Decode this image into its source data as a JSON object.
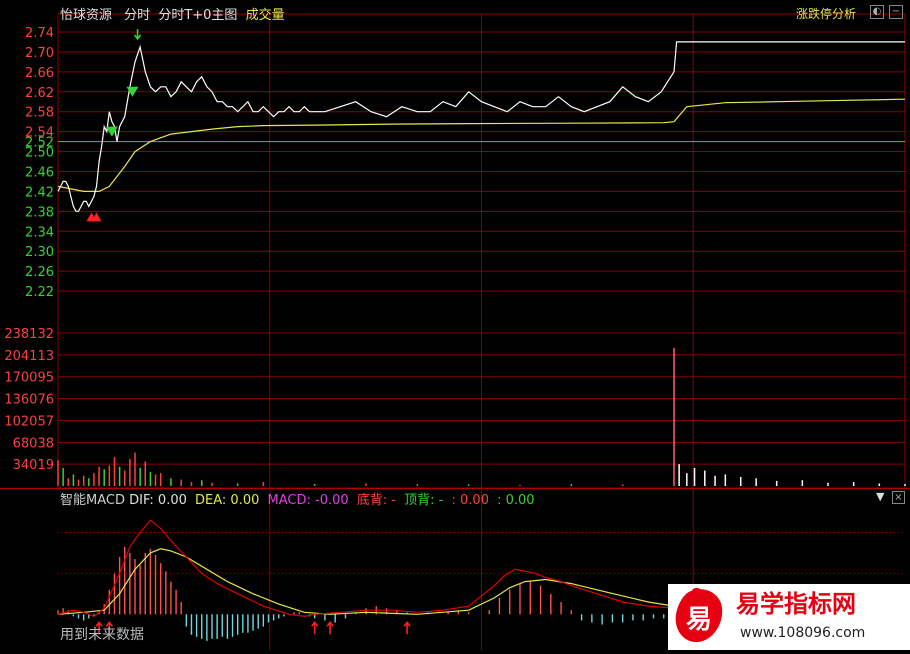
{
  "header": {
    "stock_name": "怡球资源",
    "mode_1": "分时",
    "mode_2": "分时T+0主图",
    "mode_3": "成交量",
    "analysis_label": "涨跌停分析"
  },
  "colors": {
    "price_up": "#ff4040",
    "price_down": "#35d435",
    "price_line": "#ffffff",
    "avg_line": "#e6e64a",
    "grid": "#8b0000",
    "macd_pos": "#ff5050",
    "macd_neg": "#70d8e0",
    "dea": "#e6e64a",
    "dif": "#e00000"
  },
  "chart_data": [
    {
      "type": "line",
      "panel": "price",
      "prev_close": 2.52,
      "ylim": [
        2.18,
        2.76
      ],
      "y_ticks": [
        "2.74",
        "2.70",
        "2.66",
        "2.62",
        "2.58",
        "2.54",
        "2.50",
        "2.46",
        "2.42",
        "2.38",
        "2.34",
        "2.30",
        "2.26",
        "2.22"
      ],
      "series": [
        {
          "role": "price",
          "x": [
            0,
            1,
            2,
            3,
            4,
            5,
            6,
            7,
            8,
            9,
            10,
            11,
            12,
            13,
            14,
            15,
            16,
            17,
            18,
            19,
            20,
            21,
            22,
            23,
            24,
            26,
            28,
            30,
            32,
            34,
            36,
            38,
            40,
            42,
            44,
            46,
            48,
            50,
            52,
            54,
            56,
            58,
            60,
            62,
            64,
            66,
            68,
            70,
            72,
            74,
            76,
            78,
            80,
            82,
            84,
            86,
            88,
            90,
            92,
            94,
            96,
            98,
            100,
            104,
            110,
            116,
            122,
            128,
            134,
            140,
            145,
            150,
            155,
            160,
            165,
            170,
            175,
            180,
            185,
            190,
            195,
            200,
            205,
            210,
            215,
            220,
            225,
            230,
            235,
            240,
            241,
            330
          ],
          "y": [
            2.42,
            2.43,
            2.44,
            2.44,
            2.43,
            2.41,
            2.39,
            2.38,
            2.38,
            2.39,
            2.4,
            2.4,
            2.39,
            2.4,
            2.41,
            2.43,
            2.48,
            2.51,
            2.55,
            2.54,
            2.58,
            2.56,
            2.55,
            2.52,
            2.55,
            2.57,
            2.63,
            2.68,
            2.71,
            2.66,
            2.63,
            2.62,
            2.63,
            2.63,
            2.61,
            2.62,
            2.64,
            2.63,
            2.62,
            2.64,
            2.65,
            2.63,
            2.62,
            2.6,
            2.6,
            2.59,
            2.59,
            2.58,
            2.59,
            2.6,
            2.58,
            2.58,
            2.59,
            2.58,
            2.57,
            2.58,
            2.58,
            2.59,
            2.58,
            2.58,
            2.59,
            2.58,
            2.58,
            2.58,
            2.59,
            2.6,
            2.58,
            2.57,
            2.59,
            2.58,
            2.58,
            2.6,
            2.59,
            2.62,
            2.6,
            2.59,
            2.58,
            2.6,
            2.59,
            2.59,
            2.61,
            2.59,
            2.58,
            2.59,
            2.6,
            2.63,
            2.61,
            2.6,
            2.62,
            2.66,
            2.72,
            2.72
          ]
        },
        {
          "role": "average",
          "x": [
            0,
            10,
            16,
            20,
            26,
            30,
            36,
            44,
            52,
            60,
            70,
            80,
            100,
            130,
            160,
            200,
            236,
            240,
            245,
            260,
            300,
            330
          ],
          "y": [
            2.43,
            2.42,
            2.42,
            2.43,
            2.47,
            2.5,
            2.52,
            2.535,
            2.54,
            2.545,
            2.55,
            2.552,
            2.553,
            2.555,
            2.556,
            2.557,
            2.558,
            2.56,
            2.59,
            2.598,
            2.602,
            2.605
          ]
        }
      ],
      "markers": [
        {
          "kind": "buy-arrow",
          "x": 13,
          "y": 2.37
        },
        {
          "kind": "buy-arrow",
          "x": 15,
          "y": 2.37
        },
        {
          "kind": "sell-triangle",
          "x": 21,
          "y": 2.54
        },
        {
          "kind": "sell-triangle",
          "x": 29,
          "y": 2.62
        },
        {
          "kind": "sell-arrow",
          "x": 31,
          "y": 2.73
        }
      ]
    },
    {
      "type": "bar",
      "panel": "volume",
      "ylim": [
        0,
        238132
      ],
      "y_ticks": [
        "238132",
        "204113",
        "170095",
        "136076",
        "102057",
        "68038",
        "34019"
      ],
      "x": [
        0,
        2,
        4,
        6,
        8,
        10,
        12,
        14,
        16,
        18,
        20,
        22,
        24,
        26,
        28,
        30,
        32,
        34,
        36,
        38,
        40,
        44,
        48,
        52,
        56,
        60,
        70,
        80,
        100,
        120,
        140,
        160,
        180,
        200,
        220,
        240,
        242,
        245,
        248,
        252,
        256,
        260,
        266,
        272,
        280,
        290,
        300,
        310,
        320,
        330
      ],
      "values": [
        40000,
        28000,
        12000,
        18000,
        10000,
        16000,
        12000,
        20000,
        30000,
        26000,
        32000,
        45000,
        30000,
        24000,
        42000,
        52000,
        28000,
        38000,
        22000,
        18000,
        20000,
        12000,
        10000,
        6000,
        9000,
        5000,
        4000,
        6000,
        3000,
        4000,
        3000,
        2500,
        2000,
        3000,
        2500,
        215000,
        34000,
        20000,
        28000,
        24000,
        16000,
        18000,
        14000,
        12000,
        8000,
        9000,
        5000,
        6000,
        4000,
        3000
      ],
      "up": [
        1,
        0,
        1,
        0,
        1,
        1,
        0,
        1,
        1,
        0,
        1,
        1,
        0,
        1,
        1,
        1,
        0,
        1,
        0,
        1,
        1,
        0,
        1,
        1,
        0,
        1,
        0,
        1,
        0,
        1,
        1,
        0,
        1,
        0,
        1,
        1,
        0,
        0,
        0,
        1,
        0,
        0,
        0,
        1,
        0,
        0,
        1,
        0,
        0,
        1
      ]
    },
    {
      "type": "bar",
      "panel": "macd",
      "title": "智能MACD",
      "labels": {
        "dif": "DIF: 0.00",
        "dea": "DEA: 0.00",
        "macd": "MACD: -0.00",
        "bottom": "底背: -",
        "top": "顶背: -",
        "extra_1": ": 0.00",
        "extra_2": ": 0.00"
      },
      "ylim": [
        -0.015,
        0.05
      ],
      "x": [
        0,
        2,
        4,
        6,
        8,
        10,
        12,
        14,
        16,
        18,
        20,
        22,
        24,
        26,
        28,
        30,
        32,
        34,
        36,
        38,
        40,
        42,
        44,
        46,
        48,
        50,
        52,
        54,
        56,
        58,
        60,
        62,
        64,
        66,
        68,
        70,
        72,
        74,
        76,
        78,
        80,
        82,
        84,
        86,
        88,
        90,
        92,
        94,
        96,
        98,
        100,
        104,
        108,
        112,
        116,
        120,
        124,
        128,
        132,
        136,
        140,
        144,
        148,
        152,
        156,
        160,
        164,
        168,
        172,
        176,
        180,
        184,
        188,
        192,
        196,
        200,
        204,
        208,
        212,
        216,
        220,
        224,
        228,
        232,
        236,
        240,
        244,
        248,
        252,
        256,
        260,
        264,
        268,
        272,
        276,
        280,
        284,
        290,
        300,
        310,
        320,
        330
      ],
      "values": [
        0.002,
        0.003,
        0.002,
        -0.001,
        -0.002,
        -0.003,
        -0.002,
        -0.001,
        0.001,
        0.005,
        0.012,
        0.02,
        0.028,
        0.033,
        0.03,
        0.027,
        0.024,
        0.03,
        0.032,
        0.029,
        0.025,
        0.021,
        0.016,
        0.012,
        0.006,
        -0.006,
        -0.01,
        -0.011,
        -0.012,
        -0.013,
        -0.012,
        -0.012,
        -0.011,
        -0.012,
        -0.011,
        -0.01,
        -0.009,
        -0.009,
        -0.008,
        -0.007,
        -0.006,
        -0.004,
        -0.003,
        -0.002,
        -0.001,
        0.0,
        0.001,
        0.001,
        0.0,
        -0.001,
        -0.002,
        -0.003,
        -0.004,
        -0.002,
        0.001,
        0.003,
        0.004,
        0.003,
        0.002,
        0.001,
        0.0,
        0.001,
        0.0,
        0.001,
        0.002,
        0.001,
        0.0,
        0.002,
        0.008,
        0.012,
        0.015,
        0.016,
        0.014,
        0.01,
        0.006,
        0.002,
        -0.003,
        -0.004,
        -0.005,
        -0.004,
        -0.004,
        -0.003,
        -0.003,
        -0.002,
        -0.002,
        -0.001,
        -0.001,
        -0.002,
        -0.001,
        -0.001,
        -0.001,
        -0.002,
        -0.001,
        -0.001,
        -0.001,
        -0.001,
        -0.001,
        -0.001,
        0.0,
        0.0,
        0.0,
        0.0
      ],
      "dif": {
        "x": [
          0,
          6,
          10,
          14,
          18,
          24,
          28,
          32,
          36,
          40,
          44,
          50,
          56,
          62,
          70,
          80,
          90,
          96,
          100,
          110,
          120,
          130,
          140,
          150,
          160,
          170,
          174,
          178,
          182,
          186,
          190,
          196,
          200,
          210,
          220,
          230,
          240,
          250,
          260,
          270,
          280,
          290,
          300,
          310,
          320,
          330
        ],
        "y": [
          0.0,
          0.002,
          0.001,
          -0.001,
          0.003,
          0.02,
          0.033,
          0.04,
          0.046,
          0.042,
          0.036,
          0.028,
          0.02,
          0.015,
          0.01,
          0.004,
          0.0,
          -0.001,
          0.0,
          0.001,
          0.002,
          0.002,
          0.001,
          0.002,
          0.004,
          0.014,
          0.019,
          0.022,
          0.021,
          0.02,
          0.018,
          0.016,
          0.014,
          0.01,
          0.006,
          0.004,
          0.003,
          0.002,
          0.001,
          0.001,
          0.001,
          0.0,
          0.0,
          0.0,
          0.0,
          0.0
        ]
      },
      "dea": {
        "x": [
          0,
          10,
          18,
          24,
          30,
          36,
          40,
          44,
          50,
          58,
          66,
          76,
          86,
          96,
          106,
          120,
          140,
          160,
          170,
          176,
          182,
          190,
          200,
          210,
          220,
          230,
          240,
          250,
          260,
          270,
          280,
          290,
          300,
          310,
          320,
          330
        ],
        "y": [
          0.0,
          0.001,
          0.002,
          0.01,
          0.022,
          0.03,
          0.032,
          0.031,
          0.028,
          0.022,
          0.016,
          0.01,
          0.005,
          0.001,
          0.0,
          0.001,
          0.0,
          0.002,
          0.008,
          0.013,
          0.016,
          0.017,
          0.015,
          0.012,
          0.009,
          0.006,
          0.004,
          0.003,
          0.002,
          0.001,
          0.001,
          0.0,
          0.0,
          0.0,
          0.0,
          0.0
        ]
      },
      "markers": [
        {
          "kind": "buy-arrow",
          "x": 16
        },
        {
          "kind": "buy-arrow",
          "x": 20
        },
        {
          "kind": "buy-arrow",
          "x": 100
        },
        {
          "kind": "buy-arrow",
          "x": 106
        },
        {
          "kind": "buy-arrow",
          "x": 136
        }
      ]
    }
  ],
  "footer_note": "用到未来数据",
  "logo": {
    "char": "易",
    "name": "易学指标网",
    "url": "www.108096.com"
  }
}
